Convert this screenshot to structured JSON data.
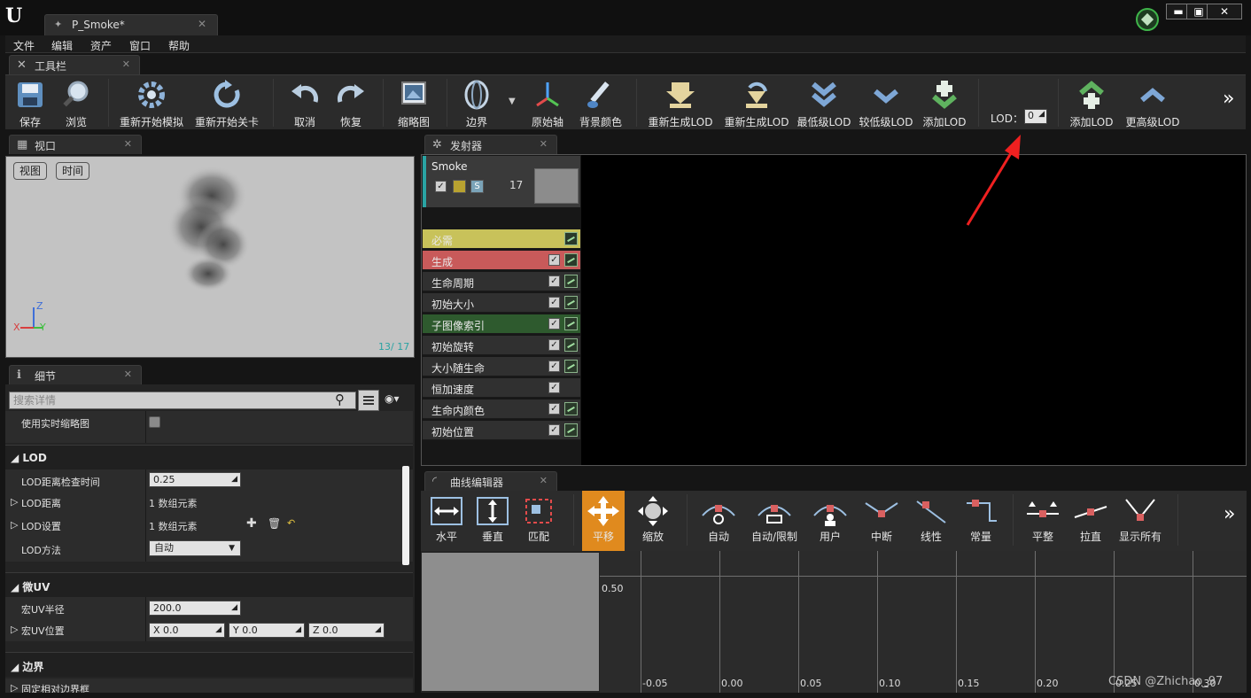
{
  "window": {
    "tab_title": "P_Smoke*",
    "controls": {
      "minimize": "▬",
      "restore": "▣",
      "close": "✕"
    }
  },
  "menu": [
    "文件",
    "编辑",
    "资产",
    "窗口",
    "帮助"
  ],
  "toolbar_panel": {
    "title": "工具栏"
  },
  "toolbar": {
    "save": "保存",
    "browse": "浏览",
    "restart_sim": "重新开始模拟",
    "restart_level": "重新开始关卡",
    "undo": "取消",
    "redo": "恢复",
    "thumbnail": "缩略图",
    "bounds": "边界",
    "origin_axis": "原始轴",
    "bg_color": "背景颜色",
    "regen_lod_1": "重新生成LOD",
    "regen_lod_2": "重新生成LOD",
    "lowest_lod": "最低级LOD",
    "lower_lod": "较低级LOD",
    "add_lod_1": "添加LOD",
    "lod_label": "LOD：",
    "lod_value": "0",
    "add_lod_2": "添加LOD",
    "higher_lod": "更高级LOD",
    "more": "»"
  },
  "viewport_panel": {
    "title": "视口",
    "view_btn": "视图",
    "time_btn": "时间",
    "axis_z": "Z",
    "axis_x": "X",
    "axis_y": "Y",
    "counter": "13/  17"
  },
  "details_panel": {
    "title": "细节",
    "search_placeholder": "搜索详情",
    "rows": {
      "realtime_thumb": "使用实时缩略图",
      "cat_lod": "LOD",
      "lod_check_time_k": "LOD距离检查时间",
      "lod_check_time_v": "0.25",
      "lod_distance_k": "LOD距离",
      "lod_distance_v": "1 数组元素",
      "lod_settings_k": "LOD设置",
      "lod_settings_v": "1 数组元素",
      "lod_method_k": "LOD方法",
      "lod_method_v": "自动",
      "cat_macro_uv": "微UV",
      "macro_uv_radius_k": "宏UV半径",
      "macro_uv_radius_v": "200.0",
      "macro_uv_pos_k": "宏UV位置",
      "macro_uv_pos_x": "X  0.0",
      "macro_uv_pos_y": "Y  0.0",
      "macro_uv_pos_z": "Z  0.0",
      "cat_bounds": "边界",
      "fixed_bounds": "固定相对边界框"
    }
  },
  "emitters_panel": {
    "title": "发射器",
    "emitter_name": "Smoke",
    "emitter_count": "17",
    "emitter_s": "S",
    "modules": [
      {
        "name": "必需",
        "color": "#c8c25a"
      },
      {
        "name": "生成",
        "color": "#c85a5a"
      },
      {
        "name": "生命周期",
        "color": "#303030"
      },
      {
        "name": "初始大小",
        "color": "#303030"
      },
      {
        "name": "子图像索引",
        "color": "#2e5a2e"
      },
      {
        "name": "初始旋转",
        "color": "#303030"
      },
      {
        "name": "大小随生命",
        "color": "#303030"
      },
      {
        "name": "恒加速度",
        "color": "#303030"
      },
      {
        "name": "生命内颜色",
        "color": "#303030"
      },
      {
        "name": "初始位置",
        "color": "#303030"
      }
    ]
  },
  "curve_editor": {
    "title": "曲线编辑器",
    "tools": {
      "horizontal": "水平",
      "vertical": "垂直",
      "fit": "匹配",
      "pan": "平移",
      "zoom": "缩放",
      "auto": "自动",
      "auto_clamp": "自动/限制",
      "user": "用户",
      "break": "中断",
      "linear": "线性",
      "constant": "常量",
      "flatten": "平整",
      "straighten": "拉直",
      "show_all": "显示所有",
      "more": "»"
    },
    "y_label": "0.50",
    "x_ticks": [
      "-0.05",
      "0.00",
      "0.05",
      "0.10",
      "0.15",
      "0.20",
      "0.25",
      "0.30"
    ],
    "watermark": "CSDN @Zhichao_97"
  }
}
